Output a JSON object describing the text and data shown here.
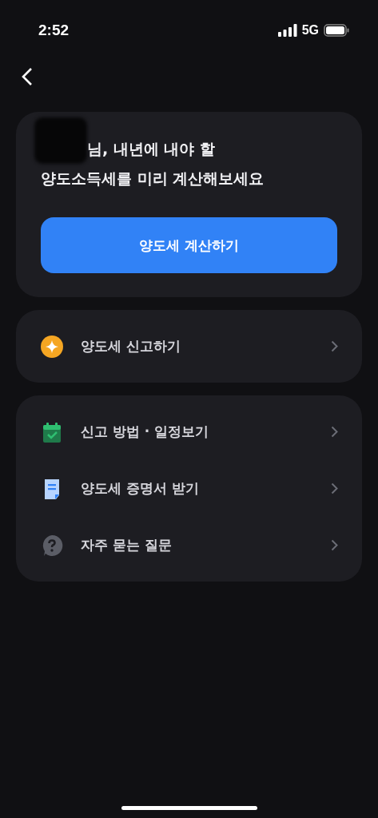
{
  "status_bar": {
    "time": "2:52",
    "network": "5G"
  },
  "intro_card": {
    "heading_line_1": "님, 내년에 내야 할",
    "heading_line_2": "양도소득세를 미리 계산해보세요",
    "button": "양도세 계산하기"
  },
  "groups": [
    {
      "items": [
        {
          "kind": "sparkle",
          "label": "양도세 신고하기"
        }
      ]
    },
    {
      "items": [
        {
          "kind": "calendar",
          "label": "신고 방법 · 일정보기"
        },
        {
          "kind": "document",
          "label": "양도세 증명서 받기"
        },
        {
          "kind": "question",
          "label": "자주 묻는 질문"
        }
      ]
    }
  ]
}
